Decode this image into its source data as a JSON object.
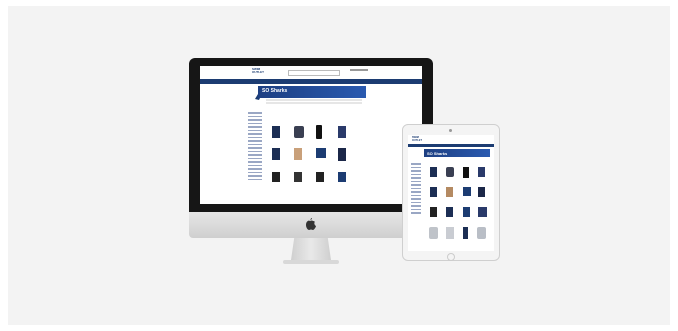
{
  "site": {
    "logo_text": "",
    "banner_title": "SO Sharks"
  },
  "colors": {
    "brand_navy": "#1c3c72",
    "banner_blue": "#2a5ab0",
    "background": "#f3f3f3"
  },
  "icons": [
    "apple-logo-icon",
    "ipad-camera-icon",
    "ipad-home-button-icon"
  ]
}
